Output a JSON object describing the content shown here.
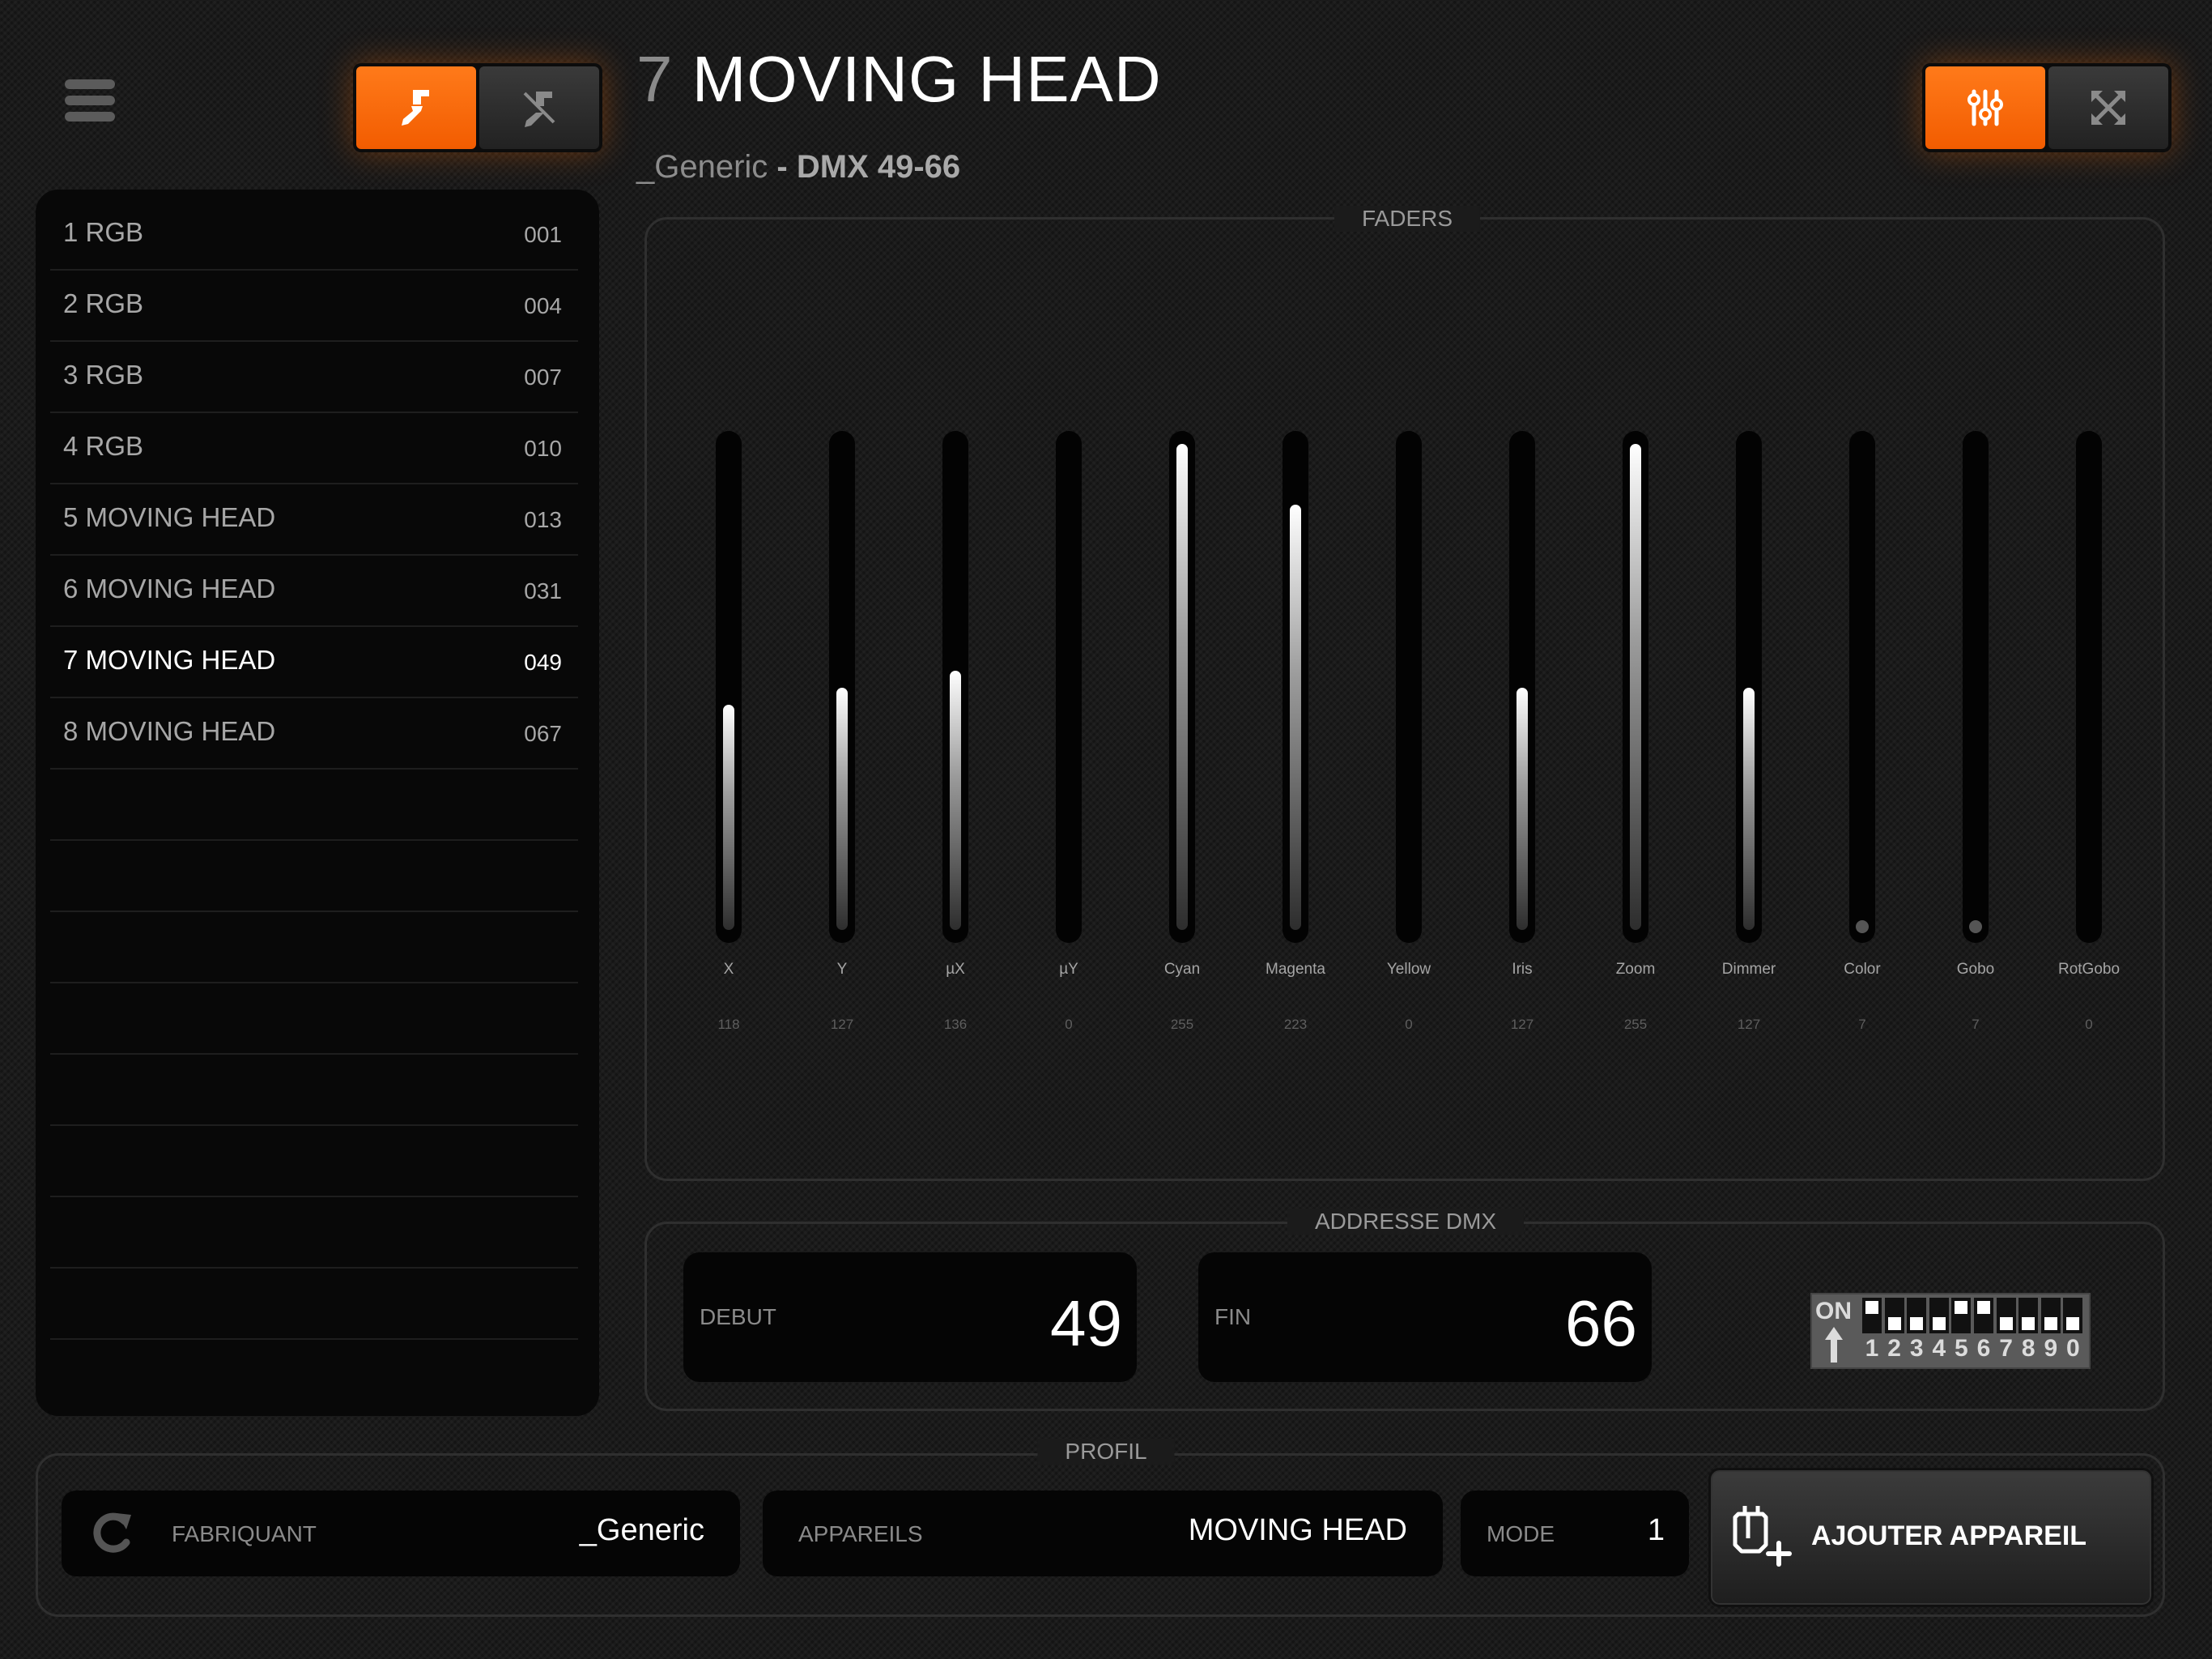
{
  "header": {
    "fixture_number": "7",
    "fixture_name": "MOVING HEAD",
    "manufacturer": "_Generic",
    "separator": " - ",
    "dmx_range": "DMX 49-66",
    "left_toggle_icons": [
      "brush-icon",
      "brush-disabled-icon"
    ],
    "right_toggle_icons": [
      "sliders-icon",
      "expand-icon"
    ],
    "accent_color": "#ff6a00"
  },
  "fixtures": [
    {
      "name": "1 RGB",
      "address": "001"
    },
    {
      "name": "2 RGB",
      "address": "004"
    },
    {
      "name": "3 RGB",
      "address": "007"
    },
    {
      "name": "4 RGB",
      "address": "010"
    },
    {
      "name": "5 MOVING HEAD",
      "address": "013"
    },
    {
      "name": "6 MOVING HEAD",
      "address": "031"
    },
    {
      "name": "7 MOVING HEAD",
      "address": "049",
      "selected": true
    },
    {
      "name": "8 MOVING HEAD",
      "address": "067"
    },
    {
      "name": "",
      "address": ""
    },
    {
      "name": "",
      "address": ""
    },
    {
      "name": "",
      "address": ""
    },
    {
      "name": "",
      "address": ""
    },
    {
      "name": "",
      "address": ""
    },
    {
      "name": "",
      "address": ""
    },
    {
      "name": "",
      "address": ""
    },
    {
      "name": "",
      "address": ""
    }
  ],
  "faders": {
    "legend": "FADERS",
    "max": 255,
    "channels": [
      {
        "label": "X",
        "value": "118",
        "level": 118
      },
      {
        "label": "Y",
        "value": "127",
        "level": 127
      },
      {
        "label": "µX",
        "value": "136",
        "level": 136
      },
      {
        "label": "µY",
        "value": "0",
        "level": 0
      },
      {
        "label": "Cyan",
        "value": "255",
        "level": 255
      },
      {
        "label": "Magenta",
        "value": "223",
        "level": 223
      },
      {
        "label": "Yellow",
        "value": "0",
        "level": 0
      },
      {
        "label": "Iris",
        "value": "127",
        "level": 127
      },
      {
        "label": "Zoom",
        "value": "255",
        "level": 255
      },
      {
        "label": "Dimmer",
        "value": "127",
        "level": 127
      },
      {
        "label": "Color",
        "value": "7",
        "level": 7
      },
      {
        "label": "Gobo",
        "value": "7",
        "level": 7
      },
      {
        "label": "RotGobo",
        "value": "0",
        "level": 0
      }
    ]
  },
  "dmx": {
    "legend": "ADDRESSE DMX",
    "start_label": "DEBUT",
    "start_value": "49",
    "end_label": "FIN",
    "end_value": "66",
    "dip_on_label": "ON",
    "dip_numbers": [
      "1",
      "2",
      "3",
      "4",
      "5",
      "6",
      "7",
      "8",
      "9",
      "0"
    ],
    "dip_states": [
      true,
      false,
      false,
      false,
      true,
      true,
      false,
      false,
      false,
      false
    ]
  },
  "profile": {
    "legend": "PROFIL",
    "manufacturer_label": "FABRIQUANT",
    "manufacturer_value": "_Generic",
    "devices_label": "APPAREILS",
    "devices_value": "MOVING HEAD",
    "mode_label": "MODE",
    "mode_value": "1",
    "add_button_label": "AJOUTER APPAREIL"
  }
}
